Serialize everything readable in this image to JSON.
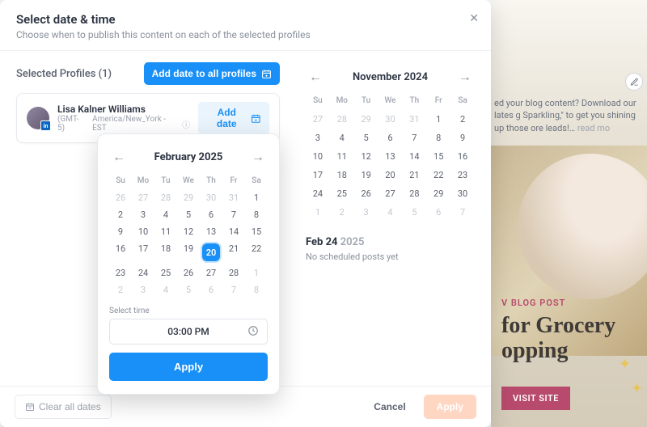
{
  "header": {
    "title": "Select date & time",
    "subtitle": "Choose when to publish this content on each of the selected profiles"
  },
  "sidebar_title": "Selected Profiles (1)",
  "add_all_label": "Add date to all profiles",
  "profile": {
    "name": "Lisa Kalner Williams",
    "tz_short": "(GMT-5)",
    "tz_zone": "America/New_York - EST",
    "add_date_label": "Add date"
  },
  "picker": {
    "month": "February 2025",
    "dow": [
      "Su",
      "Mo",
      "Tu",
      "We",
      "Th",
      "Fr",
      "Sa"
    ],
    "rows": [
      [
        {
          "d": "26",
          "m": true
        },
        {
          "d": "27",
          "m": true
        },
        {
          "d": "28",
          "m": true
        },
        {
          "d": "29",
          "m": true
        },
        {
          "d": "30",
          "m": true
        },
        {
          "d": "31",
          "m": true
        },
        {
          "d": "1"
        }
      ],
      [
        {
          "d": "2"
        },
        {
          "d": "3"
        },
        {
          "d": "4"
        },
        {
          "d": "5"
        },
        {
          "d": "6"
        },
        {
          "d": "7"
        },
        {
          "d": "8"
        }
      ],
      [
        {
          "d": "9"
        },
        {
          "d": "10"
        },
        {
          "d": "11"
        },
        {
          "d": "12"
        },
        {
          "d": "13"
        },
        {
          "d": "14"
        },
        {
          "d": "15"
        }
      ],
      [
        {
          "d": "16"
        },
        {
          "d": "17"
        },
        {
          "d": "18"
        },
        {
          "d": "19"
        },
        {
          "d": "20",
          "sel": true
        },
        {
          "d": "21"
        },
        {
          "d": "22"
        }
      ],
      [
        {
          "d": "23"
        },
        {
          "d": "24"
        },
        {
          "d": "25"
        },
        {
          "d": "26"
        },
        {
          "d": "27"
        },
        {
          "d": "28"
        },
        {
          "d": "1",
          "m": true
        }
      ],
      [
        {
          "d": "2",
          "m": true
        },
        {
          "d": "3",
          "m": true
        },
        {
          "d": "4",
          "m": true
        },
        {
          "d": "5",
          "m": true
        },
        {
          "d": "6",
          "m": true
        },
        {
          "d": "7",
          "m": true
        },
        {
          "d": "8",
          "m": true
        }
      ]
    ],
    "select_time_label": "Select time",
    "time_value": "03:00 PM",
    "apply_label": "Apply"
  },
  "right_cal": {
    "month": "November 2024",
    "dow": [
      "Su",
      "Mo",
      "Tu",
      "We",
      "Th",
      "Fr",
      "Sa"
    ],
    "rows": [
      [
        {
          "d": "27",
          "m": true
        },
        {
          "d": "28",
          "m": true
        },
        {
          "d": "29",
          "m": true
        },
        {
          "d": "30",
          "m": true
        },
        {
          "d": "31",
          "m": true
        },
        {
          "d": "1"
        },
        {
          "d": "2"
        }
      ],
      [
        {
          "d": "3"
        },
        {
          "d": "4"
        },
        {
          "d": "5"
        },
        {
          "d": "6"
        },
        {
          "d": "7"
        },
        {
          "d": "8"
        },
        {
          "d": "9"
        }
      ],
      [
        {
          "d": "10"
        },
        {
          "d": "11"
        },
        {
          "d": "12"
        },
        {
          "d": "13"
        },
        {
          "d": "14"
        },
        {
          "d": "15"
        },
        {
          "d": "16"
        }
      ],
      [
        {
          "d": "17"
        },
        {
          "d": "18"
        },
        {
          "d": "19"
        },
        {
          "d": "20"
        },
        {
          "d": "21"
        },
        {
          "d": "22"
        },
        {
          "d": "23"
        }
      ],
      [
        {
          "d": "24"
        },
        {
          "d": "25"
        },
        {
          "d": "26"
        },
        {
          "d": "27"
        },
        {
          "d": "28"
        },
        {
          "d": "29"
        },
        {
          "d": "30"
        }
      ],
      [
        {
          "d": "1",
          "m": true
        },
        {
          "d": "2",
          "m": true
        },
        {
          "d": "3",
          "m": true
        },
        {
          "d": "4",
          "m": true
        },
        {
          "d": "5",
          "m": true
        },
        {
          "d": "6",
          "m": true
        },
        {
          "d": "7",
          "m": true
        }
      ]
    ],
    "selected_day": "Feb 24",
    "selected_year": "2025",
    "no_posts": "No scheduled posts yet"
  },
  "footer": {
    "clear_label": "Clear all dates",
    "cancel_label": "Cancel",
    "apply_label": "Apply"
  },
  "background": {
    "blurb": "ed your blog content? Download our lates g Sparkling,\" to get you shining up those ore leads!…",
    "read_more": "read mo",
    "badge": "V BLOG POST",
    "title1": "for Grocery",
    "title2": "opping",
    "visit": "VISIT SITE"
  }
}
